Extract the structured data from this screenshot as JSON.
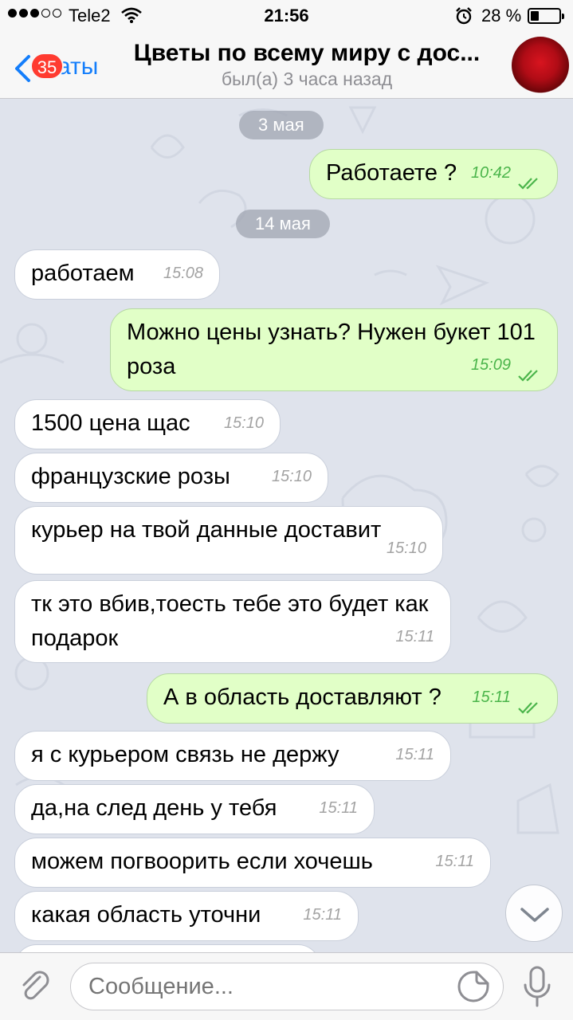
{
  "status_bar": {
    "carrier": "Tele2",
    "time": "21:56",
    "battery": "28 %",
    "battery_level": 0.28
  },
  "header": {
    "back_label": "Чаты",
    "unread_badge": "35",
    "title": "Цветы по всему миру с дос...",
    "subtitle": "был(а) 3 часа назад"
  },
  "chat": {
    "dates": [
      "3 мая",
      "14 мая"
    ],
    "messages": [
      {
        "dir": "out",
        "text": "Работаете ?",
        "time": "10:42"
      },
      {
        "dir": "in",
        "text": "работаем",
        "time": "15:08"
      },
      {
        "dir": "out",
        "text": "Можно цены узнать? Нужен букет 101 роза",
        "time": "15:09"
      },
      {
        "dir": "in",
        "text": "1500 цена щас",
        "time": "15:10"
      },
      {
        "dir": "in",
        "text": "французские розы",
        "time": "15:10"
      },
      {
        "dir": "in",
        "text": "курьер на твой данные доставит",
        "time": "15:10"
      },
      {
        "dir": "in",
        "text": "тк это вбив,тоесть тебе это будет как подарок",
        "time": "15:11"
      },
      {
        "dir": "out",
        "text": "А в область доставляют ?",
        "time": "15:11"
      },
      {
        "dir": "in",
        "text": "я с курьером связь не держу",
        "time": "15:11"
      },
      {
        "dir": "in",
        "text": "да,на след день у тебя",
        "time": "15:11"
      },
      {
        "dir": "in",
        "text": "можем погвоорить если хочешь",
        "time": "15:11"
      },
      {
        "dir": "in",
        "text": "какая область уточни",
        "time": "15:11"
      }
    ]
  },
  "input": {
    "placeholder": "Сообщение..."
  },
  "icons": {
    "back": "chevron-left-icon",
    "attach": "paperclip-icon",
    "sticker": "sticker-icon",
    "mic": "microphone-icon",
    "scroll": "chevron-down-icon",
    "read": "double-check-icon"
  },
  "colors": {
    "accent": "#147efb",
    "outgoing_bubble": "#e1ffc7",
    "incoming_bubble": "#ffffff",
    "badge": "#ff3b30",
    "read_check": "#4bb54b"
  }
}
